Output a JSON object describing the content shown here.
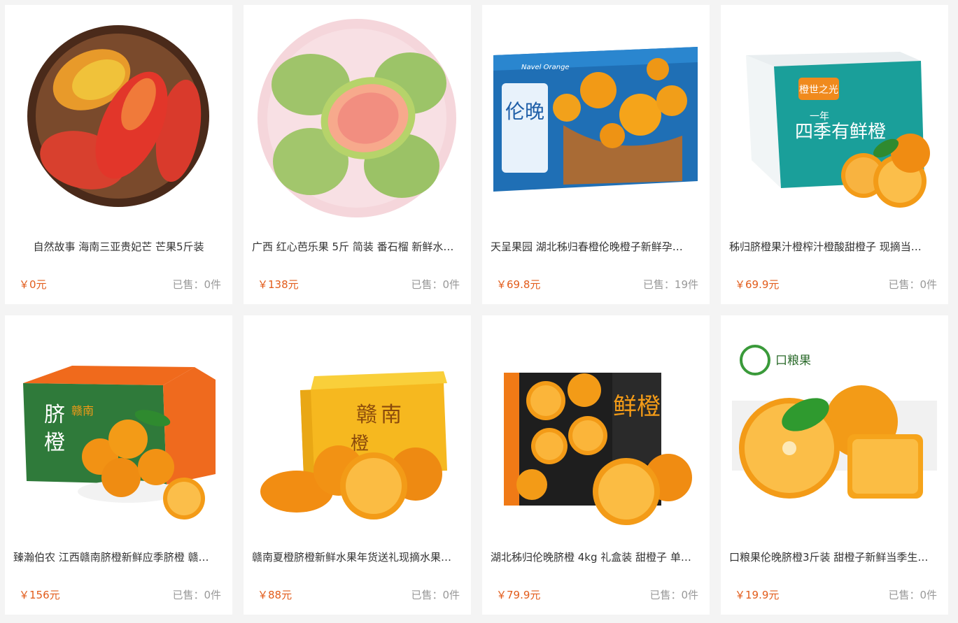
{
  "products": [
    {
      "title": "自然故事 海南三亚贵妃芒 芒果5斤装",
      "price": "￥0元",
      "sold_label": "已售：",
      "sold": "0件",
      "image_icon": "mango-image"
    },
    {
      "title": "广西 红心芭乐果 5斤 简装 番石榴 新鲜水…",
      "price": "￥138元",
      "sold_label": "已售：",
      "sold": "0件",
      "image_icon": "guava-image"
    },
    {
      "title": "天呈果园 湖北秭归春橙伦晚橙子新鲜孕…",
      "price": "￥69.8元",
      "sold_label": "已售：",
      "sold": "19件",
      "image_icon": "orange-box-image"
    },
    {
      "title": "秭归脐橙果汁橙榨汁橙酸甜橙子 现摘当…",
      "price": "￥69.9元",
      "sold_label": "已售：",
      "sold": "0件",
      "image_icon": "orange-box-image"
    },
    {
      "title": "臻瀚伯农 江西赣南脐橙新鲜应季脐橙 赣…",
      "price": "￥156元",
      "sold_label": "已售：",
      "sold": "0件",
      "image_icon": "orange-box-image"
    },
    {
      "title": "赣南夏橙脐橙新鲜水果年货送礼现摘水果…",
      "price": "￥88元",
      "sold_label": "已售：",
      "sold": "0件",
      "image_icon": "orange-box-image"
    },
    {
      "title": "湖北秭归伦晚脐橙 4kg 礼盒装 甜橙子 单…",
      "price": "￥79.9元",
      "sold_label": "已售：",
      "sold": "0件",
      "image_icon": "orange-box-image"
    },
    {
      "title": "口粮果伦晚脐橙3斤装 甜橙子新鲜当季生…",
      "price": "￥19.9元",
      "sold_label": "已售：",
      "sold": "0件",
      "image_icon": "orange-image"
    }
  ],
  "image_text": {
    "box1": "伦晚",
    "box1_en": "Navel Orange",
    "box2_brand": "橙世之光",
    "box2_line1": "一年",
    "box2_line2": "四季有鲜橙",
    "box3_a": "脐",
    "box3_b": "橙",
    "box3_c": "赣南",
    "box4_a": "赣",
    "box4_b": "南",
    "box4_c": "橙",
    "box5": "鲜橙",
    "logo": "口粮果"
  },
  "colors": {
    "price": "#e25c1b",
    "sold": "#999999",
    "title": "#333333",
    "page_bg": "#f4f4f4",
    "card_bg": "#ffffff"
  }
}
